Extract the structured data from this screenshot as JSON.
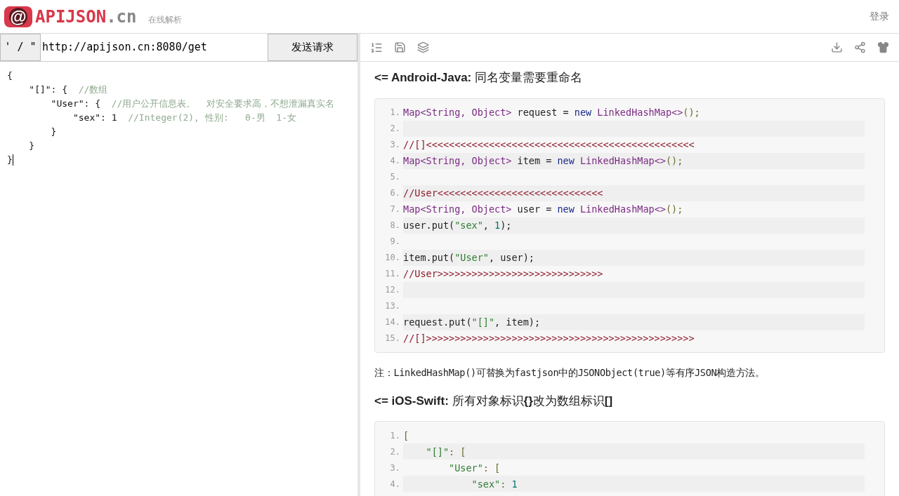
{
  "header": {
    "logo_symbol": "@",
    "logo_name": "APIJSON",
    "logo_suffix": ".cn",
    "subtitle": "在线解析",
    "login": "登录"
  },
  "request": {
    "quote_toggle": "' / \"",
    "url": "http://apijson.cn:8080/get",
    "send_button": "发送请求"
  },
  "editor": {
    "lines": [
      [
        {
          "kind": "plain",
          "text": "{"
        }
      ],
      [
        {
          "kind": "plain",
          "text": "    \"[]\": {  "
        },
        {
          "kind": "comment",
          "text": "//数组"
        }
      ],
      [
        {
          "kind": "plain",
          "text": "        \"User\": {  "
        },
        {
          "kind": "comment",
          "text": "//用户公开信息表。  对安全要求高，不想泄漏真实名"
        }
      ],
      [
        {
          "kind": "plain",
          "text": "            \"sex\": 1  "
        },
        {
          "kind": "comment",
          "text": "//Integer(2), 性别:   0-男  1-女"
        }
      ],
      [
        {
          "kind": "plain",
          "text": "        }"
        }
      ],
      [
        {
          "kind": "plain",
          "text": "    }"
        }
      ],
      [
        {
          "kind": "plain",
          "text": "}"
        }
      ]
    ]
  },
  "sections": [
    {
      "kind": "code",
      "heading": "**<= Android-Java:** 同名变量需要重命名",
      "lines": [
        {
          "num": "1.",
          "tokens": [
            {
              "kind": "type",
              "text": "Map<String, Object>"
            },
            {
              "kind": "plain",
              "text": " request = "
            },
            {
              "kind": "keyword",
              "text": "new"
            },
            {
              "kind": "type",
              "text": " LinkedHashMap<>"
            },
            {
              "kind": "punct",
              "text": "();"
            }
          ]
        },
        {
          "num": "2."
        },
        {
          "num": "3.",
          "tokens": [
            {
              "kind": "comment",
              "text": "//[]<<<<<<<<<<<<<<<<<<<<<<<<<<<<<<<<<<<<<<<<<<<<<<<"
            }
          ]
        },
        {
          "num": "4.",
          "tokens": [
            {
              "kind": "type",
              "text": "Map<String, Object>"
            },
            {
              "kind": "plain",
              "text": " item = "
            },
            {
              "kind": "keyword",
              "text": "new"
            },
            {
              "kind": "type",
              "text": " LinkedHashMap<>"
            },
            {
              "kind": "punct",
              "text": "();"
            }
          ]
        },
        {
          "num": "5."
        },
        {
          "num": "6.",
          "tokens": [
            {
              "kind": "comment",
              "text": "//User<<<<<<<<<<<<<<<<<<<<<<<<<<<<<"
            }
          ]
        },
        {
          "num": "7.",
          "tokens": [
            {
              "kind": "type",
              "text": "Map<String, Object>"
            },
            {
              "kind": "plain",
              "text": " user = "
            },
            {
              "kind": "keyword",
              "text": "new"
            },
            {
              "kind": "type",
              "text": " LinkedHashMap<>"
            },
            {
              "kind": "punct",
              "text": "();"
            }
          ]
        },
        {
          "num": "8.",
          "tokens": [
            {
              "kind": "plain",
              "text": "user.put("
            },
            {
              "kind": "string",
              "text": "\"sex\""
            },
            {
              "kind": "plain",
              "text": ", "
            },
            {
              "kind": "number",
              "text": "1"
            },
            {
              "kind": "plain",
              "text": ");"
            }
          ]
        },
        {
          "num": "9."
        },
        {
          "num": "10.",
          "tokens": [
            {
              "kind": "plain",
              "text": "item.put("
            },
            {
              "kind": "string",
              "text": "\"User\""
            },
            {
              "kind": "plain",
              "text": ", user);"
            }
          ]
        },
        {
          "num": "11.",
          "tokens": [
            {
              "kind": "comment",
              "text": "//User>>>>>>>>>>>>>>>>>>>>>>>>>>>>>"
            }
          ]
        },
        {
          "num": "12."
        },
        {
          "num": "13."
        },
        {
          "num": "14.",
          "tokens": [
            {
              "kind": "plain",
              "text": "request.put("
            },
            {
              "kind": "string",
              "text": "\"[]\""
            },
            {
              "kind": "plain",
              "text": ", item);"
            }
          ]
        },
        {
          "num": "15.",
          "tokens": [
            {
              "kind": "comment",
              "text": "//[]>>>>>>>>>>>>>>>>>>>>>>>>>>>>>>>>>>>>>>>>>>>>>>>"
            }
          ]
        }
      ]
    },
    {
      "kind": "note",
      "text": "注：LinkedHashMap()可替换为fastjson中的JSONObject(true)等有序JSON构造方法。"
    },
    {
      "kind": "code",
      "heading": "**<= iOS-Swift:** 所有对象标识**{}**改为数组标识**[]**",
      "lines": [
        {
          "num": "1.",
          "tokens": [
            {
              "kind": "punct",
              "text": "["
            }
          ]
        },
        {
          "num": "2.",
          "tokens": [
            {
              "kind": "string",
              "text": "    \"[]\""
            },
            {
              "kind": "punct",
              "text": ": ["
            }
          ]
        },
        {
          "num": "3.",
          "tokens": [
            {
              "kind": "string",
              "text": "        \"User\""
            },
            {
              "kind": "punct",
              "text": ": ["
            }
          ]
        },
        {
          "num": "4.",
          "tokens": [
            {
              "kind": "string",
              "text": "            \"sex\""
            },
            {
              "kind": "punct",
              "text": ": "
            },
            {
              "kind": "number",
              "text": "1"
            }
          ]
        }
      ]
    }
  ]
}
